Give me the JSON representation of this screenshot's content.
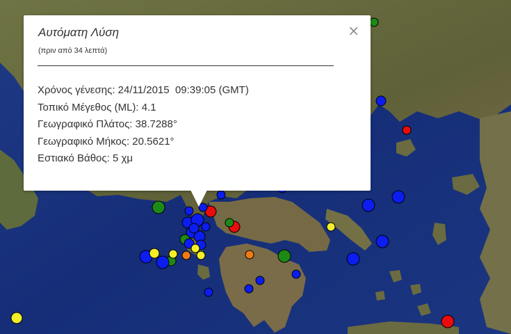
{
  "popup": {
    "title": "Αυτόματη Λύση",
    "subtitle": "(πριν από 34 λεπτά)",
    "close_symbol": "×",
    "lines": [
      "Χρόνος γένεσης: 24/11/2015  09:39:05 (GMT)",
      "Τοπικό Μέγεθος (ML): 4.1",
      "Γεωγραφικό Πλάτος: 38.7288°",
      "Γεωγραφικό Μήκος: 20.5621°",
      "Εστιακό Βάθος: 5 χμ"
    ]
  },
  "colors": {
    "sea": "#17307c",
    "land": "#6d6e3f",
    "marker_blue": "#0c1df0",
    "marker_red": "#e80c0c",
    "marker_green": "#1d8a16",
    "marker_yellow": "#f2ee28",
    "marker_orange": "#ef7a16"
  }
}
